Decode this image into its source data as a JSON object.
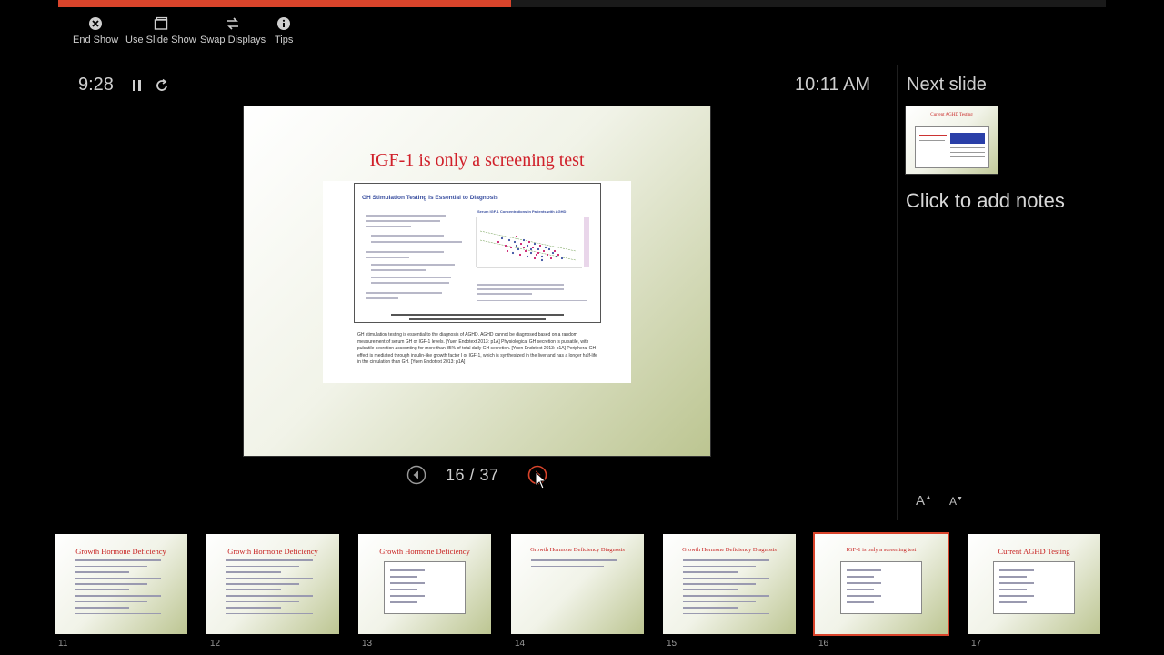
{
  "app": {
    "toolbar": {
      "end_show": "End Show",
      "use_slide_show": "Use Slide Show",
      "swap_displays": "Swap Displays",
      "tips": "Tips"
    },
    "timer": "9:28",
    "clock": "10:11 AM",
    "progress": 0.432
  },
  "current_slide": {
    "title": "IGF-1 is only a screening test",
    "inner_slide_title": "GH Stimulation Testing is Essential to Diagnosis",
    "inner_chart_title": "Serum IGF-1 Concentrations in Patients with AGHD",
    "notes_text": "GH stimulation testing is essential to the diagnosis of AGHD. AGHD cannot be diagnosed based on a random measurement of serum GH or IGF-1 levels. [Yuen Endotext 2013: p1A] Physiological GH secretion is pulsatile, with pulsatile secretion accounting for more than 85% of total daily GH secretion. [Yuen Endotext 2013: p1A] Peripheral GH effect is mediated through insulin-like growth factor I or IGF-1, which is synthesized in the liver and has a longer half-life in the circulation than GH. [Yuen Endotext 2013: p1A]"
  },
  "navigation": {
    "counter": "16 / 37"
  },
  "right_panel": {
    "next_label": "Next slide",
    "next_thumb_title": "Current AGHD Testing",
    "notes_placeholder": "Click to add notes",
    "font_increase": "A",
    "font_decrease": "A"
  },
  "filmstrip": [
    {
      "num": "11",
      "title": "Growth Hormone Deficiency",
      "style": "text"
    },
    {
      "num": "12",
      "title": "Growth Hormone Deficiency",
      "style": "text"
    },
    {
      "num": "13",
      "title": "Growth Hormone Deficiency",
      "style": "box"
    },
    {
      "num": "14",
      "title": "Growth Hormone Deficiency Diagnosis",
      "style": "sparse"
    },
    {
      "num": "15",
      "title": "Growth Hormone Deficiency Diagnosis",
      "style": "text"
    },
    {
      "num": "16",
      "title": "IGF-1 is only a screening test",
      "style": "box",
      "active": true
    },
    {
      "num": "17",
      "title": "Current AGHD Testing",
      "style": "box"
    }
  ],
  "colors": {
    "accent": "#d9442b",
    "slide_title": "#d0202a",
    "inner_title": "#3a4fa0"
  }
}
